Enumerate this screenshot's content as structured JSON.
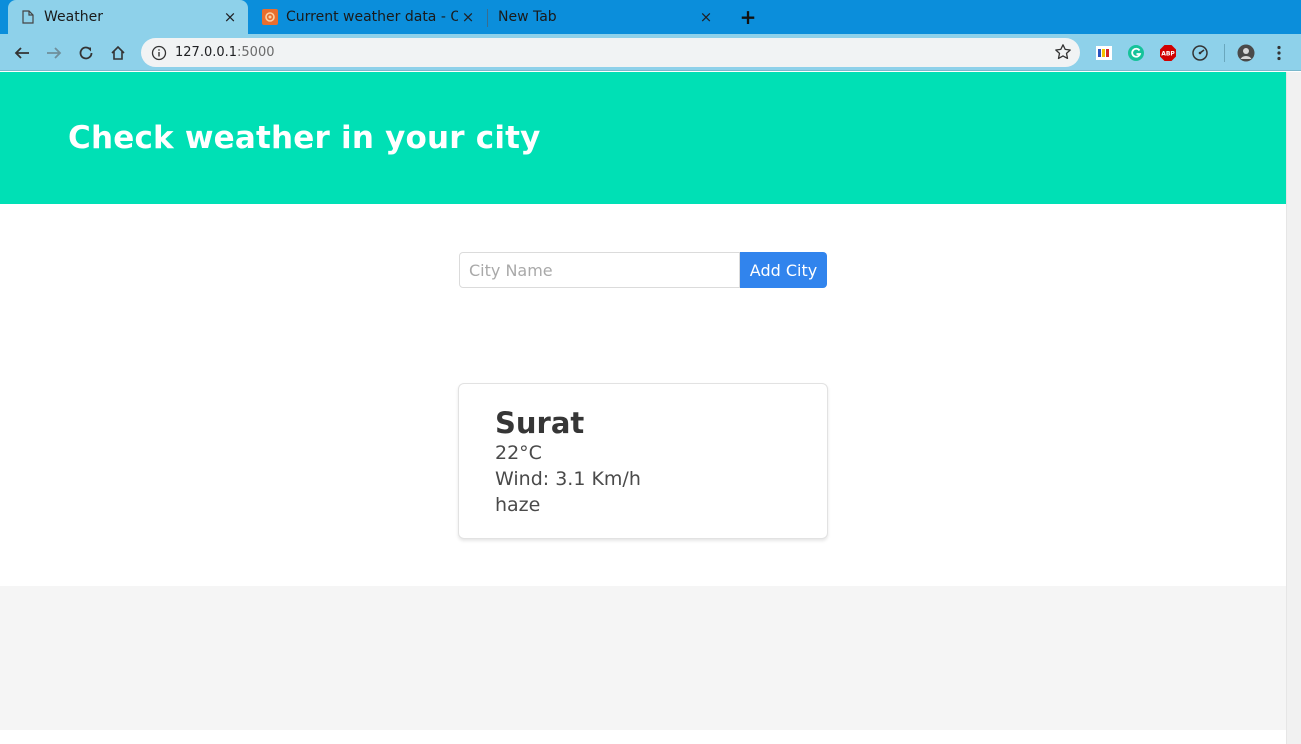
{
  "browser": {
    "tabs": [
      {
        "title": "Weather",
        "active": true,
        "icon": "page-icon"
      },
      {
        "title": "Current weather data - Op",
        "active": false,
        "icon": "openweather-icon"
      },
      {
        "title": "New Tab",
        "active": false,
        "icon": ""
      }
    ],
    "tab_close": "×",
    "new_tab": "+",
    "url_host": "127.0.0.1",
    "url_port": ":5000",
    "colors": {
      "tabbar": "#0b8edb",
      "toolbar": "#8ed1ea"
    }
  },
  "hero": {
    "title": "Check weather in your city",
    "color": "#00e0b5"
  },
  "form": {
    "placeholder": "City Name",
    "value": "",
    "button_label": "Add City",
    "button_color": "#3184ed"
  },
  "cards": [
    {
      "city": "Surat",
      "temperature": "22°C",
      "wind": "Wind: 3.1 Km/h",
      "description": "haze"
    }
  ]
}
